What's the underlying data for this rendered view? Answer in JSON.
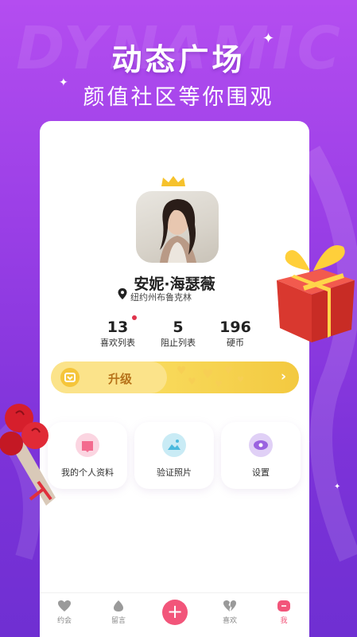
{
  "promo": {
    "watermark": "DYNAMIC",
    "headline": "动态广场",
    "subheadline": "颜值社区等你围观"
  },
  "profile": {
    "name": "安妮·海瑟薇",
    "location": "纽约州布鲁克林"
  },
  "stats": [
    {
      "value": "13",
      "label": "喜欢列表",
      "has_badge": true
    },
    {
      "value": "5",
      "label": "阻止列表",
      "has_badge": false
    },
    {
      "value": "196",
      "label": "硬币",
      "has_badge": false
    }
  ],
  "upgrade": {
    "label": "升级",
    "arrow": "›"
  },
  "tiles": [
    {
      "label": "我的个人资料",
      "icon": "profile-icon",
      "color": "#f9c6d6"
    },
    {
      "label": "验证照片",
      "icon": "photo-icon",
      "color": "#bfe6f3"
    },
    {
      "label": "设置",
      "icon": "settings-icon",
      "color": "#d8c4f3"
    }
  ],
  "tabbar": {
    "items": [
      {
        "label": "约会",
        "icon": "heart-icon"
      },
      {
        "label": "留言",
        "icon": "drop-icon"
      },
      {
        "label": "+",
        "icon": "plus-icon"
      },
      {
        "label": "喜欢",
        "icon": "broken-heart-icon"
      },
      {
        "label": "我",
        "icon": "me-icon",
        "active": true
      }
    ]
  },
  "colors": {
    "background": "#9a3fe6",
    "accent_pink": "#f2557a",
    "upgrade_yellow": "#f8d95a"
  }
}
